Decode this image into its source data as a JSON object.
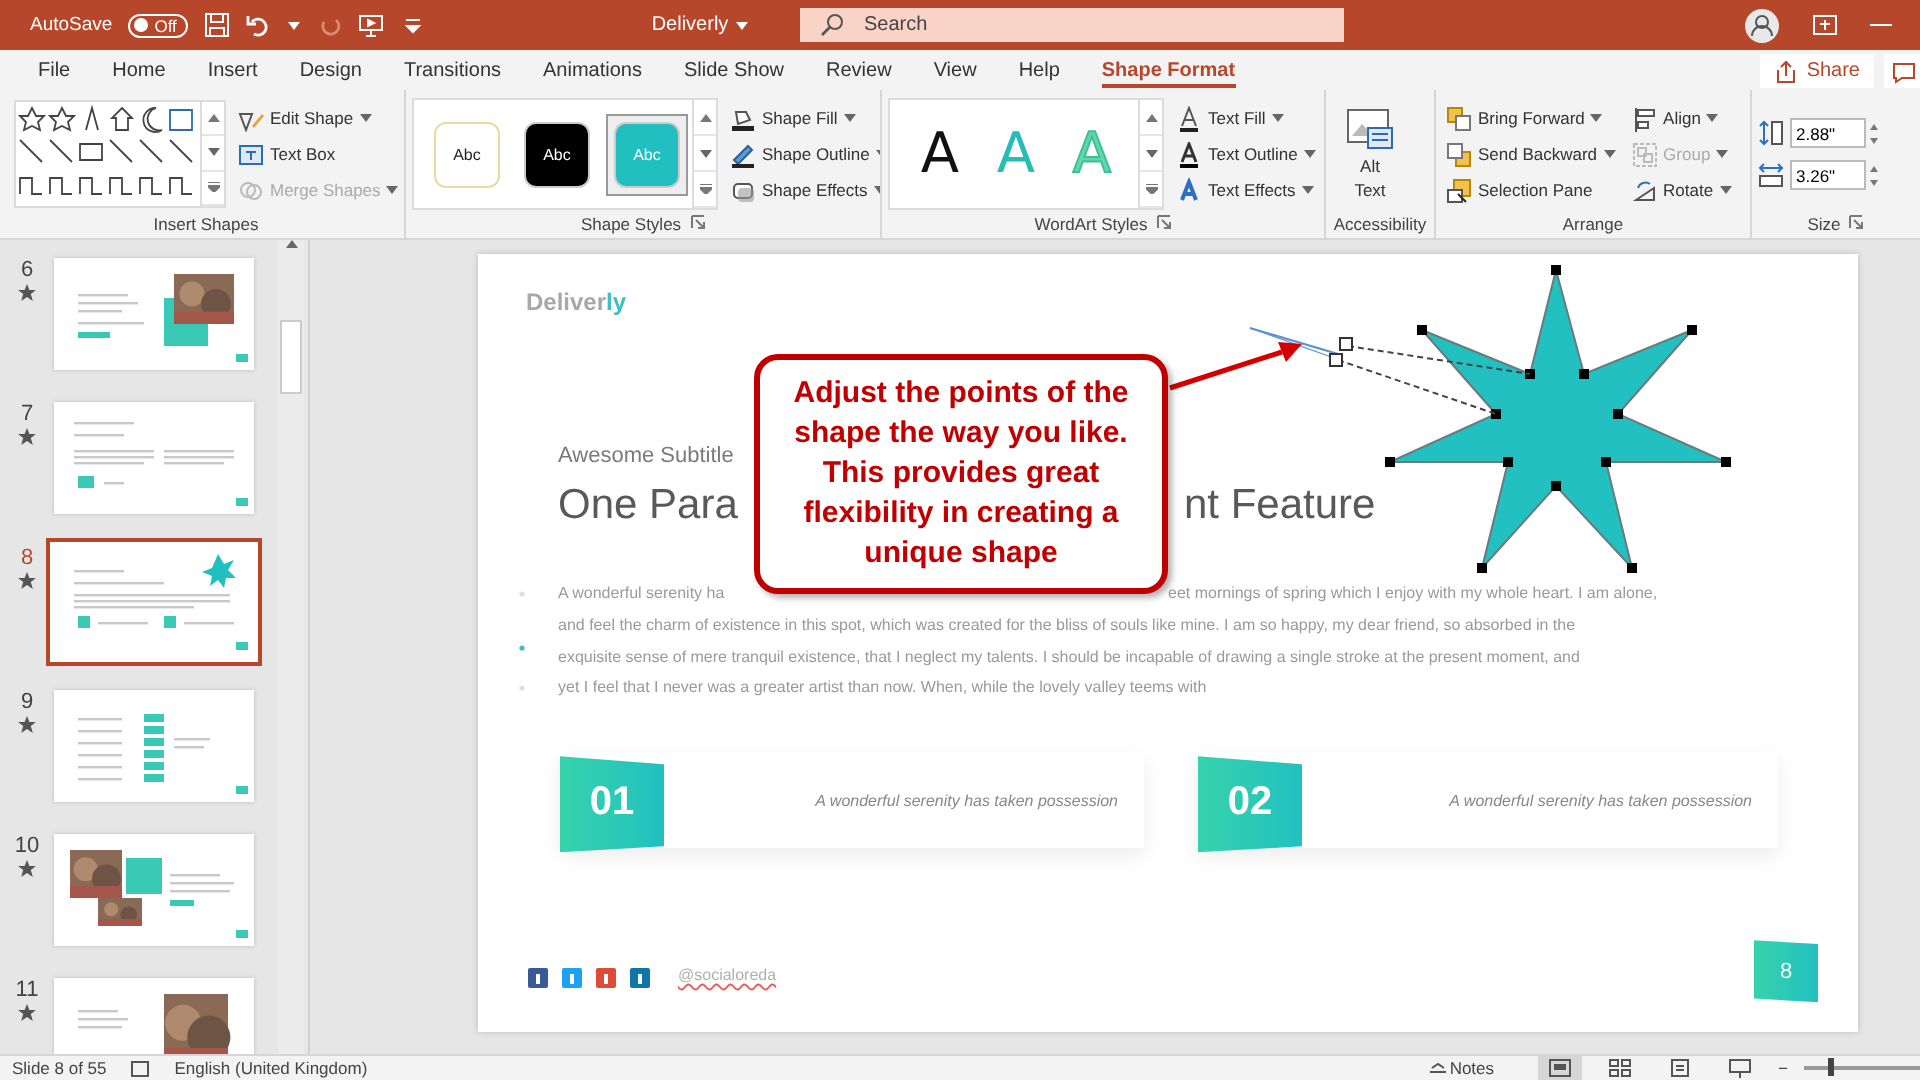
{
  "title_bar": {
    "autosave_label": "AutoSave",
    "autosave": {
      "label": "Off",
      "on": false
    },
    "title": "Deliverly",
    "search": {
      "placeholder": "Search"
    }
  },
  "tabs": [
    {
      "label": "File",
      "selected": false
    },
    {
      "label": "Home",
      "selected": false
    },
    {
      "label": "Insert",
      "selected": false
    },
    {
      "label": "Design",
      "selected": false
    },
    {
      "label": "Transitions",
      "selected": false
    },
    {
      "label": "Animations",
      "selected": false
    },
    {
      "label": "Slide Show",
      "selected": false
    },
    {
      "label": "Review",
      "selected": false
    },
    {
      "label": "View",
      "selected": false
    },
    {
      "label": "Help",
      "selected": false
    },
    {
      "label": "Shape Format",
      "selected": true
    }
  ],
  "share": {
    "label": "Share"
  },
  "ribbon": {
    "groups": [
      {
        "kind": "insert_shapes",
        "label": "Insert Shapes",
        "buttons": [
          {
            "label": "Edit Shape",
            "dropdown": true,
            "disabled": false
          },
          {
            "label": "Text Box",
            "dropdown": false,
            "disabled": false
          },
          {
            "label": "Merge Shapes",
            "dropdown": true,
            "disabled": true
          }
        ]
      },
      {
        "kind": "shape_styles",
        "label": "Shape Styles",
        "styles": [
          {
            "label": "Abc",
            "color": "#ffffff",
            "selected": false
          },
          {
            "label": "Abc",
            "color": "#000000",
            "selected": false
          },
          {
            "label": "Abc",
            "color": "#22bfc0",
            "selected": true
          }
        ],
        "buttons": [
          {
            "label": "Shape Fill",
            "dropdown": true,
            "disabled": false
          },
          {
            "label": "Shape Outline",
            "dropdown": true,
            "disabled": false
          },
          {
            "label": "Shape Effects",
            "dropdown": true,
            "disabled": false
          }
        ]
      },
      {
        "kind": "wordart",
        "label": "WordArt Styles",
        "styles": [
          {
            "label": "A",
            "kind": "fill",
            "color": "#111111"
          },
          {
            "label": "A",
            "kind": "fill",
            "color": "#26bdb5"
          },
          {
            "label": "A",
            "kind": "outline",
            "color": "#5fd8b0"
          }
        ],
        "buttons": [
          {
            "label": "Text Fill",
            "dropdown": true,
            "disabled": false
          },
          {
            "label": "Text Outline",
            "dropdown": true,
            "disabled": false
          },
          {
            "label": "Text Effects",
            "dropdown": true,
            "disabled": false
          }
        ]
      },
      {
        "kind": "accessibility",
        "label": "Accessibility",
        "buttons": [
          {
            "label": "Alt Text",
            "dropdown": false,
            "disabled": false
          }
        ]
      },
      {
        "kind": "arrange",
        "label": "Arrange",
        "buttons": [
          {
            "label": "Bring Forward",
            "dropdown": true,
            "disabled": false
          },
          {
            "label": "Send Backward",
            "dropdown": true,
            "disabled": false
          },
          {
            "label": "Selection Pane",
            "dropdown": false,
            "disabled": false
          },
          {
            "label": "Align",
            "dropdown": true,
            "disabled": false
          },
          {
            "label": "Group",
            "dropdown": true,
            "disabled": true
          },
          {
            "label": "Rotate",
            "dropdown": true,
            "disabled": false
          }
        ]
      },
      {
        "kind": "size",
        "label": "Size",
        "fields": [
          {
            "value": "2.88\""
          },
          {
            "value": "3.26\""
          }
        ]
      }
    ]
  },
  "slides": [
    {
      "number": "6",
      "kind": "photo_right",
      "selected": false
    },
    {
      "number": "7",
      "kind": "columns",
      "selected": false
    },
    {
      "number": "8",
      "kind": "star",
      "selected": true
    },
    {
      "number": "9",
      "kind": "list",
      "selected": false
    },
    {
      "number": "10",
      "kind": "photos_left",
      "selected": false
    },
    {
      "number": "11",
      "kind": "photo_cutoff",
      "selected": false
    }
  ],
  "slide": {
    "logo": {
      "main": "Deliver",
      "accent": "ly"
    },
    "subtitle": "Awesome Subtitle",
    "title_parts": [
      "One Para",
      "nt Feature"
    ],
    "paragraph_first_parts": [
      "A wonderful serenity ha",
      "eet mornings of spring which I enjoy with my whole heart. I am alone,"
    ],
    "paragraph_lines": [
      "and feel the charm of existence in this spot, which was created for the bliss of souls like mine. I am so happy, my dear friend, so absorbed in the",
      "exquisite sense of mere tranquil existence, that I neglect my talents. I should be incapable of drawing a single stroke at the present moment, and",
      "yet I feel that I never was a greater artist than now. When, while the lovely valley teems with"
    ],
    "features": [
      {
        "number": "01",
        "text": "A wonderful serenity has taken possession"
      },
      {
        "number": "02",
        "text": "A wonderful serenity has taken possession"
      }
    ],
    "social_handle": "@socialoreda",
    "page_number": "8",
    "callout": "Adjust the points of the shape the way you like. This provides great flexibility in creating a unique shape"
  },
  "status_bar": {
    "slide_info": "Slide 8 of 55",
    "language": "English (United Kingdom)",
    "notes": "Notes",
    "views": [
      {
        "kind": "normal",
        "selected": true
      },
      {
        "kind": "sorter",
        "selected": false
      },
      {
        "kind": "reading",
        "selected": false
      },
      {
        "kind": "slideshow",
        "selected": false
      }
    ],
    "zoom": {
      "minus": "−",
      "level": 0.2
    }
  }
}
